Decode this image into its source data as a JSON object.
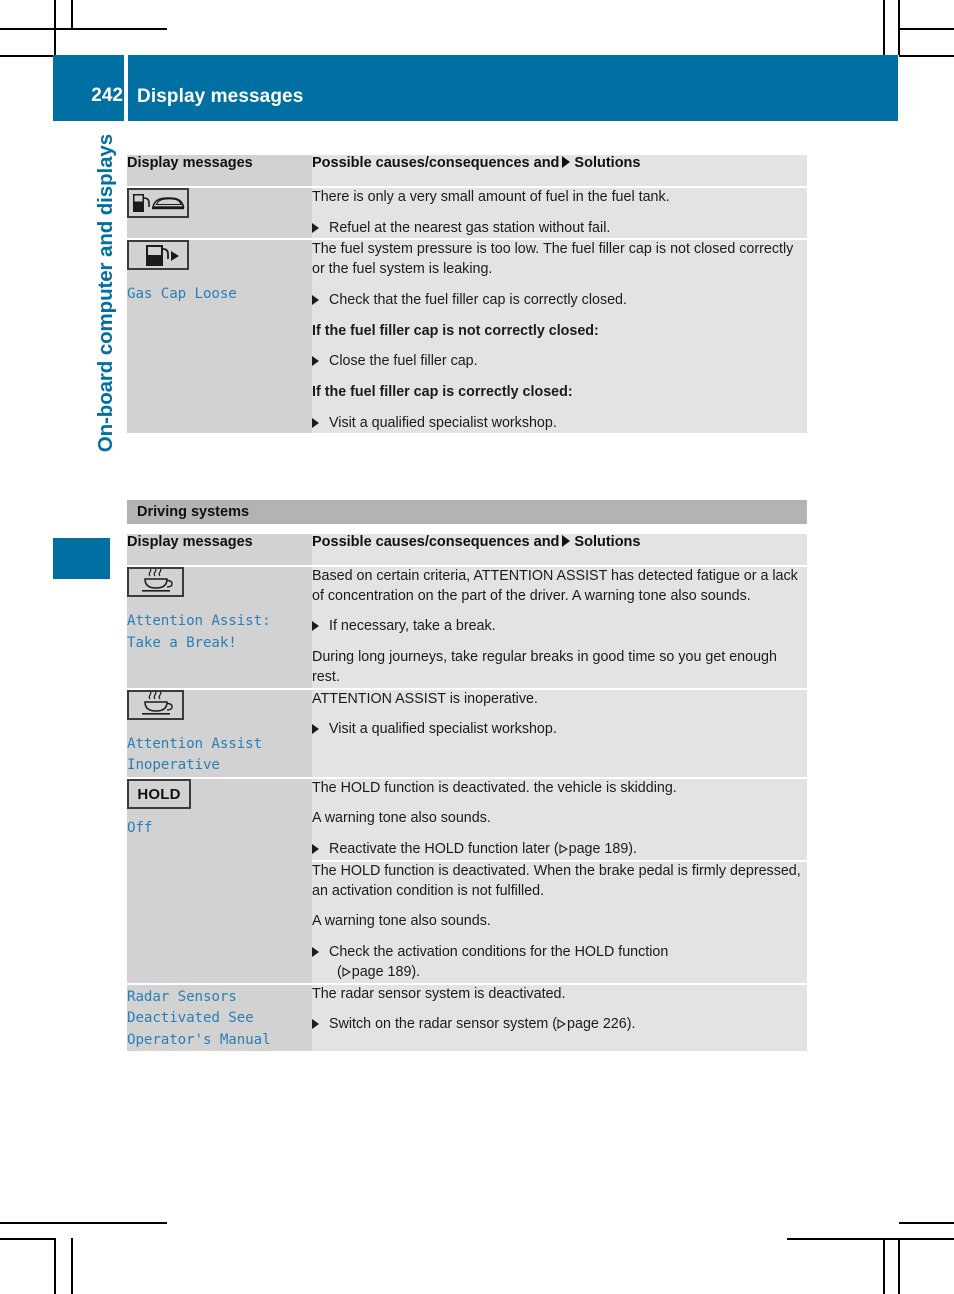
{
  "header": {
    "page_number": "242",
    "title": "Display messages",
    "band_color": "#0070a3"
  },
  "chapter": {
    "title": "On-board computer and displays",
    "color": "#0070a3"
  },
  "tables": [
    {
      "name": "fuel-messages",
      "columns": {
        "left": "Display messages",
        "right_pre": "Possible causes/consequences and",
        "right_post": "Solutions"
      },
      "rows": [
        {
          "icon": "fuel-pump-car-icon",
          "code": "",
          "blocks": [
            {
              "type": "text",
              "text": "There is only a very small amount of fuel in the fuel tank."
            },
            {
              "type": "solution",
              "text": "Refuel at the nearest gas station without fail."
            }
          ]
        },
        {
          "icon": "fuel-pump-arrow-icon",
          "code": "Gas Cap Loose",
          "blocks": [
            {
              "type": "text",
              "text": "The fuel system pressure is too low. The fuel filler cap is not closed correctly or the fuel system is leaking."
            },
            {
              "type": "solution",
              "text": "Check that the fuel filler cap is correctly closed."
            },
            {
              "type": "bold",
              "text": "If the fuel filler cap is not correctly closed:"
            },
            {
              "type": "solution",
              "text": "Close the fuel filler cap."
            },
            {
              "type": "bold",
              "text": "If the fuel filler cap is correctly closed:"
            },
            {
              "type": "solution",
              "text": "Visit a qualified specialist workshop."
            }
          ]
        }
      ]
    },
    {
      "name": "driving-systems",
      "section_title": "Driving systems",
      "columns": {
        "left": "Display messages",
        "right_pre": "Possible causes/consequences and",
        "right_post": "Solutions"
      },
      "rows": [
        {
          "icon": "coffee-cup-icon",
          "code": "Attention Assist:\nTake a Break!",
          "blocks": [
            {
              "type": "text",
              "text": "Based on certain criteria, ATTENTION ASSIST has detected fatigue or a lack of concentration on the part of the driver. A warning tone also sounds."
            },
            {
              "type": "solution",
              "text": "If necessary, take a break."
            },
            {
              "type": "text",
              "text": "During long journeys, take regular breaks in good time so you get enough rest."
            }
          ]
        },
        {
          "icon": "coffee-cup-icon",
          "code": "Attention Assist\nInoperative",
          "blocks": [
            {
              "type": "text",
              "text": "ATTENTION ASSIST is inoperative."
            },
            {
              "type": "solution",
              "text": "Visit a qualified specialist workshop."
            }
          ]
        },
        {
          "icon": "hold-icon",
          "icon_label": "HOLD",
          "code": "Off",
          "groups": [
            {
              "blocks": [
                {
                  "type": "text",
                  "text": "The HOLD function is deactivated. the vehicle is skidding."
                },
                {
                  "type": "text",
                  "text": "A warning tone also sounds."
                },
                {
                  "type": "solution_pageref",
                  "text": "Reactivate the HOLD function later (",
                  "page": "page 189",
                  "tail": ")."
                }
              ]
            },
            {
              "blocks": [
                {
                  "type": "text",
                  "text": "The HOLD function is deactivated. When the brake pedal is firmly depressed, an activation condition is not fulfilled."
                },
                {
                  "type": "text",
                  "text": "A warning tone also sounds."
                },
                {
                  "type": "solution_pageref_wrap",
                  "text": "Check the activation conditions for the HOLD function",
                  "page": "page 189",
                  "tail": ")."
                }
              ]
            }
          ]
        },
        {
          "icon": "",
          "code": "Radar Sensors\nDeactivated See\nOperator's Manual",
          "blocks": [
            {
              "type": "text",
              "text": "The radar sensor system is deactivated."
            },
            {
              "type": "solution_pageref",
              "text": "Switch on the radar sensor system (",
              "page": "page 226",
              "tail": ")."
            }
          ]
        }
      ]
    }
  ]
}
